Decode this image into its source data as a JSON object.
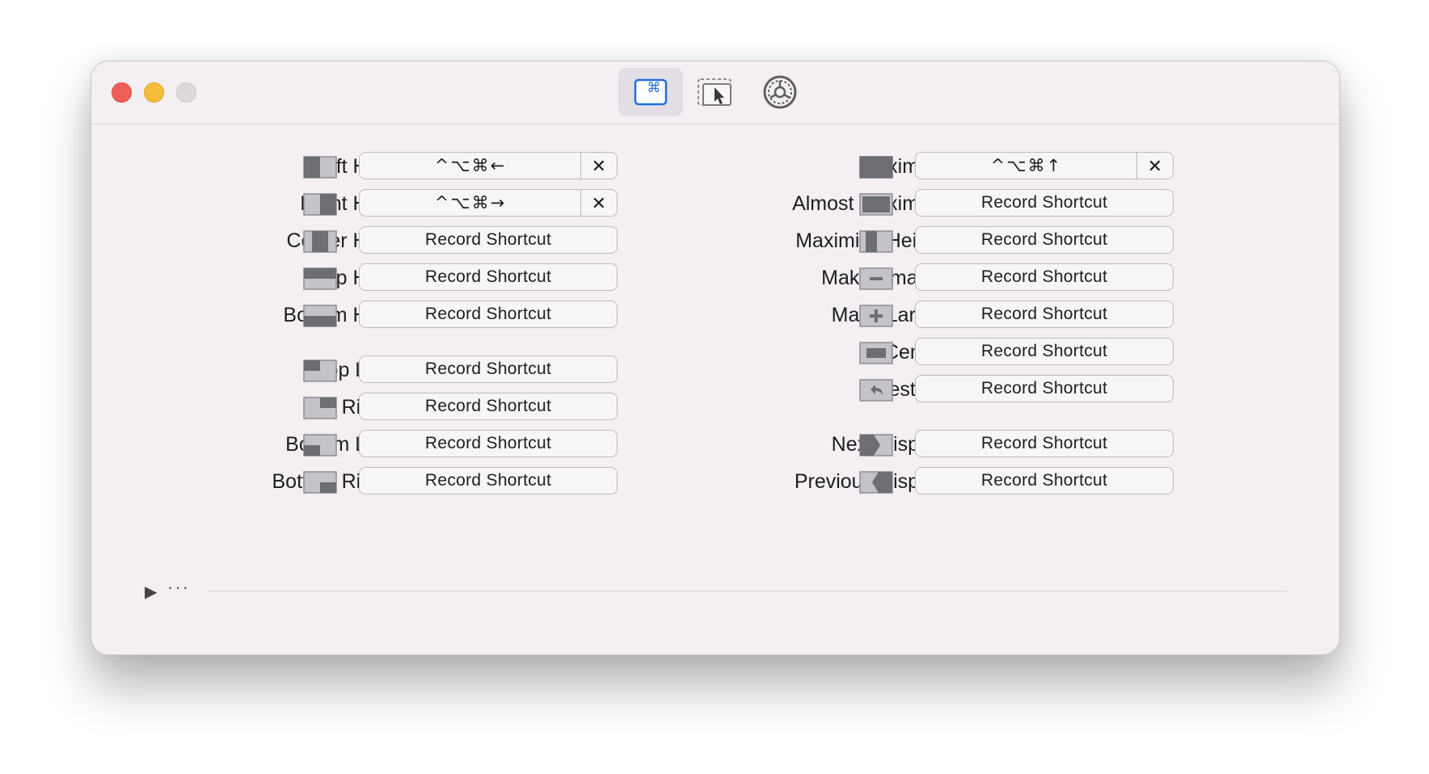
{
  "window": {
    "toolbar": [
      {
        "name": "keyboard-shortcuts-tab",
        "icon": "command-key-icon",
        "active": true
      },
      {
        "name": "snap-areas-tab",
        "icon": "window-pointer-icon",
        "active": false
      },
      {
        "name": "general-settings-tab",
        "icon": "gear-icon",
        "active": false
      }
    ]
  },
  "clear_glyph": "✕",
  "left_column": [
    {
      "label": "Left Half",
      "icon": "left-half-icon",
      "shortcut": "^⌥⌘←"
    },
    {
      "label": "Right Half",
      "icon": "right-half-icon",
      "shortcut": "^⌥⌘→"
    },
    {
      "label": "Center Half",
      "icon": "center-half-icon",
      "shortcut": "Record Shortcut"
    },
    {
      "label": "Top Half",
      "icon": "top-half-icon",
      "shortcut": "Record Shortcut"
    },
    {
      "label": "Bottom Half",
      "icon": "bottom-half-icon",
      "shortcut": "Record Shortcut"
    },
    {
      "label": "Top Left",
      "icon": "top-left-icon",
      "shortcut": "Record Shortcut"
    },
    {
      "label": "Top Right",
      "icon": "top-right-icon",
      "shortcut": "Record Shortcut"
    },
    {
      "label": "Bottom Left",
      "icon": "bottom-left-icon",
      "shortcut": "Record Shortcut"
    },
    {
      "label": "Bottom Right",
      "icon": "bottom-right-icon",
      "shortcut": "Record Shortcut"
    }
  ],
  "right_column": [
    {
      "label": "Maximize",
      "icon": "maximize-icon",
      "shortcut": "^⌥⌘↑"
    },
    {
      "label": "Almost Maximize",
      "icon": "almost-maximize-icon",
      "shortcut": "Record Shortcut"
    },
    {
      "label": "Maximize Height",
      "icon": "maximize-height-icon",
      "shortcut": "Record Shortcut"
    },
    {
      "label": "Make Smaller",
      "icon": "minus-icon",
      "shortcut": "Record Shortcut"
    },
    {
      "label": "Make Larger",
      "icon": "plus-icon",
      "shortcut": "Record Shortcut"
    },
    {
      "label": "Center",
      "icon": "center-icon",
      "shortcut": "Record Shortcut"
    },
    {
      "label": "Restore",
      "icon": "restore-icon",
      "shortcut": "Record Shortcut"
    },
    {
      "label": "Next Display",
      "icon": "next-display-icon",
      "shortcut": "Record Shortcut"
    },
    {
      "label": "Previous Display",
      "icon": "previous-display-icon",
      "shortcut": "Record Shortcut"
    }
  ],
  "footer": {
    "disclosure": "▶",
    "more": "···"
  },
  "colors": {
    "close": "#ee5f57",
    "minimize": "#f5bd3c",
    "zoom": "#dcd8dc",
    "icon_dark": "#6b6a6e",
    "icon_light": "#b9b7bc",
    "accent": "#1f6fe0"
  }
}
